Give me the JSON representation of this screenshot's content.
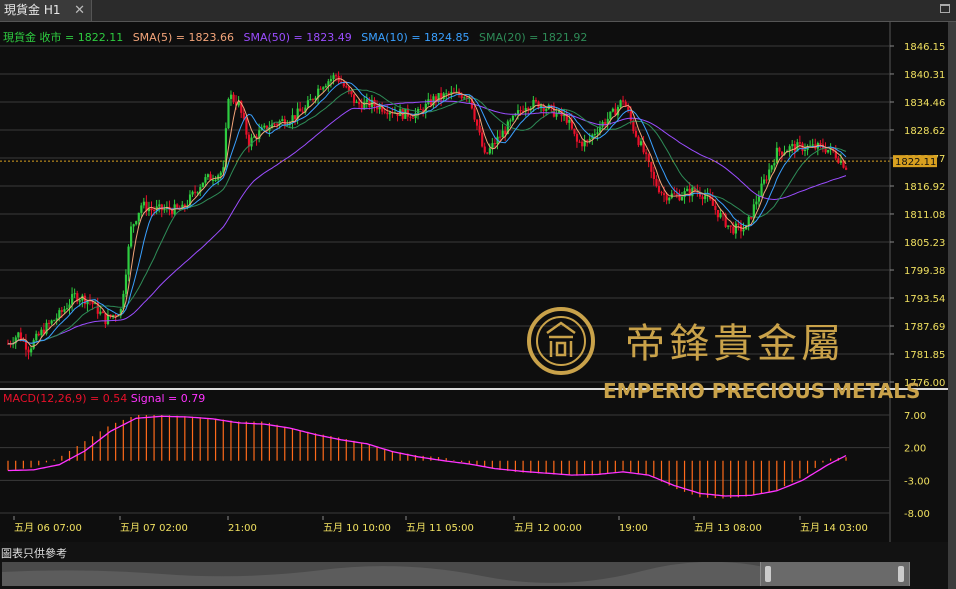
{
  "tab": {
    "label": "現貨金 H1",
    "close_glyph": "✕"
  },
  "legend": {
    "symbol": "現貨金 收市 = 1822.11",
    "sma5": "SMA(5) = 1823.66",
    "sma50": "SMA(50) = 1823.49",
    "sma10": "SMA(10) = 1824.85",
    "sma20": "SMA(20) = 1821.92"
  },
  "macd_legend": {
    "macd": "MACD(12,26,9) = 0.54",
    "signal": "Signal = 0.79"
  },
  "price_axis": [
    "1846.15",
    "1840.31",
    "1834.46",
    "1828.62",
    "1822.77",
    "1816.92",
    "1811.08",
    "1805.23",
    "1799.38",
    "1793.54",
    "1787.69",
    "1781.85",
    "1776.00"
  ],
  "current_price": "1822.11",
  "macd_axis": [
    "7.00",
    "2.00",
    "-3.00",
    "-8.00"
  ],
  "time_axis": [
    "五月 06 07:00",
    "五月 07 02:00",
    "21:00",
    "五月 10 10:00",
    "五月 11 05:00",
    "五月 12 00:00",
    "19:00",
    "五月 13 08:00",
    "五月 14 03:00"
  ],
  "logo": {
    "chinese": "帝鋒貴金屬",
    "english": "EMPERIO PRECIOUS METALS"
  },
  "disclaimer": "圖表只供參考",
  "colors": {
    "up": "#2ecc40",
    "down": "#e8102a",
    "sma5": "#f4a57a",
    "sma10": "#3aa0ff",
    "sma20": "#2e8b57",
    "sma50": "#9b4dff",
    "signal": "#ff33ff",
    "macd_bar": "#ff6a1a",
    "axis_text": "#f0e060",
    "gold": "#c9a24a"
  },
  "chart_data": {
    "type": "candlestick",
    "title": "現貨金 H1",
    "ylim": [
      1776.0,
      1846.15
    ],
    "price_path": [
      [
        0,
        1784
      ],
      [
        4,
        1786
      ],
      [
        8,
        1783
      ],
      [
        14,
        1787
      ],
      [
        20,
        1790
      ],
      [
        26,
        1794
      ],
      [
        32,
        1793
      ],
      [
        38,
        1789
      ],
      [
        44,
        1791
      ],
      [
        48,
        1808
      ],
      [
        52,
        1813
      ],
      [
        56,
        1812
      ],
      [
        62,
        1812
      ],
      [
        68,
        1812
      ],
      [
        72,
        1815
      ],
      [
        76,
        1818
      ],
      [
        80,
        1819
      ],
      [
        84,
        1820
      ],
      [
        86,
        1836
      ],
      [
        90,
        1834
      ],
      [
        94,
        1826
      ],
      [
        98,
        1828
      ],
      [
        104,
        1830
      ],
      [
        110,
        1831
      ],
      [
        116,
        1833
      ],
      [
        122,
        1838
      ],
      [
        128,
        1840
      ],
      [
        132,
        1837
      ],
      [
        136,
        1834
      ],
      [
        142,
        1834
      ],
      [
        148,
        1833
      ],
      [
        154,
        1832
      ],
      [
        160,
        1832
      ],
      [
        166,
        1835
      ],
      [
        172,
        1836
      ],
      [
        180,
        1836
      ],
      [
        186,
        1823
      ],
      [
        190,
        1826
      ],
      [
        196,
        1830
      ],
      [
        202,
        1834
      ],
      [
        208,
        1834
      ],
      [
        214,
        1832
      ],
      [
        218,
        1831
      ],
      [
        222,
        1826
      ],
      [
        226,
        1826
      ],
      [
        230,
        1829
      ],
      [
        236,
        1832
      ],
      [
        240,
        1835
      ],
      [
        244,
        1829
      ],
      [
        248,
        1824
      ],
      [
        252,
        1818
      ],
      [
        256,
        1815
      ],
      [
        262,
        1815
      ],
      [
        268,
        1816
      ],
      [
        272,
        1815
      ],
      [
        276,
        1812
      ],
      [
        282,
        1808
      ],
      [
        288,
        1808
      ],
      [
        292,
        1814
      ],
      [
        296,
        1819
      ],
      [
        300,
        1824
      ],
      [
        306,
        1825
      ],
      [
        312,
        1825
      ],
      [
        318,
        1825
      ],
      [
        322,
        1824
      ],
      [
        327,
        1821
      ]
    ],
    "macd": [
      [
        0,
        -1.5
      ],
      [
        10,
        -1
      ],
      [
        20,
        0.5
      ],
      [
        30,
        3
      ],
      [
        40,
        5.5
      ],
      [
        50,
        7
      ],
      [
        60,
        7
      ],
      [
        70,
        6.8
      ],
      [
        80,
        6.5
      ],
      [
        90,
        6
      ],
      [
        100,
        6
      ],
      [
        110,
        5
      ],
      [
        120,
        4.2
      ],
      [
        130,
        3.5
      ],
      [
        140,
        2.6
      ],
      [
        150,
        1.5
      ],
      [
        160,
        0.8
      ],
      [
        170,
        0.5
      ],
      [
        180,
        -0.5
      ],
      [
        190,
        -1.3
      ],
      [
        200,
        -1.8
      ],
      [
        210,
        -2
      ],
      [
        220,
        -2.3
      ],
      [
        230,
        -2.2
      ],
      [
        240,
        -1.5
      ],
      [
        250,
        -2.2
      ],
      [
        260,
        -4.2
      ],
      [
        270,
        -5.6
      ],
      [
        280,
        -5.8
      ],
      [
        290,
        -5.4
      ],
      [
        300,
        -4.5
      ],
      [
        310,
        -2.5
      ],
      [
        320,
        0.3
      ],
      [
        327,
        0.54
      ]
    ],
    "signal": [
      [
        0,
        -1.5
      ],
      [
        10,
        -1.4
      ],
      [
        20,
        -0.6
      ],
      [
        30,
        1.5
      ],
      [
        40,
        4.5
      ],
      [
        50,
        6.5
      ],
      [
        60,
        6.8
      ],
      [
        70,
        6.7
      ],
      [
        80,
        6.4
      ],
      [
        90,
        5.8
      ],
      [
        100,
        5.6
      ],
      [
        110,
        5
      ],
      [
        120,
        4
      ],
      [
        130,
        3.2
      ],
      [
        140,
        2.6
      ],
      [
        150,
        1.4
      ],
      [
        160,
        0.6
      ],
      [
        170,
        0
      ],
      [
        180,
        -0.5
      ],
      [
        190,
        -1.2
      ],
      [
        200,
        -1.6
      ],
      [
        210,
        -1.9
      ],
      [
        220,
        -2.2
      ],
      [
        230,
        -2.1
      ],
      [
        240,
        -1.7
      ],
      [
        250,
        -2.2
      ],
      [
        260,
        -3.8
      ],
      [
        270,
        -5
      ],
      [
        280,
        -5.4
      ],
      [
        290,
        -5.3
      ],
      [
        300,
        -4.6
      ],
      [
        310,
        -3
      ],
      [
        320,
        -0.6
      ],
      [
        327,
        0.79
      ]
    ],
    "macd_ylim": [
      -8,
      7
    ],
    "series": [
      {
        "name": "SMA(5)",
        "value": 1823.66
      },
      {
        "name": "SMA(10)",
        "value": 1824.85
      },
      {
        "name": "SMA(20)",
        "value": 1821.92
      },
      {
        "name": "SMA(50)",
        "value": 1823.49
      }
    ]
  }
}
